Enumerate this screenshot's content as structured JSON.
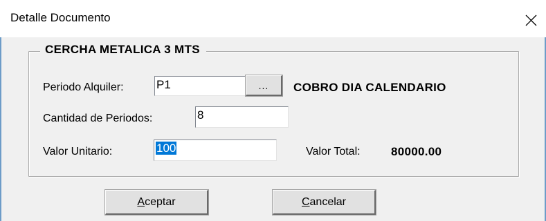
{
  "window": {
    "title": "Detalle Documento",
    "close_icon": "close-icon"
  },
  "group": {
    "title": "CERCHA METALICA 3 MTS"
  },
  "periodo": {
    "label": "Periodo Alquiler:",
    "value": "P1",
    "browse_label": "...",
    "description": "COBRO DIA CALENDARIO"
  },
  "cantidad": {
    "label": "Cantidad de Periodos:",
    "value": "8"
  },
  "valor_unitario": {
    "label": "Valor Unitario:",
    "value": "100"
  },
  "valor_total": {
    "label": "Valor Total:",
    "value": "80000.00"
  },
  "buttons": {
    "accept": {
      "mnemonic": "A",
      "rest": "ceptar"
    },
    "cancel": {
      "mnemonic": "C",
      "rest": "ancelar"
    }
  },
  "colors": {
    "selection": "#0078d7",
    "window_border": "#6d9cc8",
    "dialog_bg": "#f0f0f0"
  }
}
